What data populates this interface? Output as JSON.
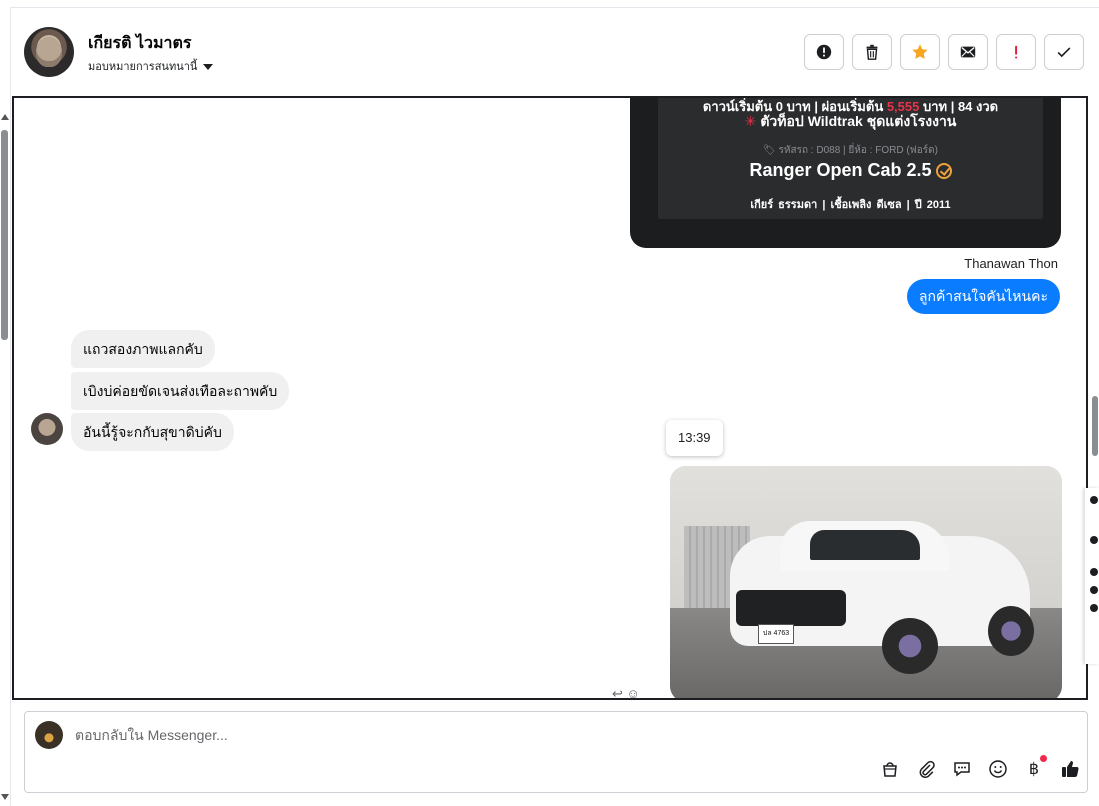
{
  "header": {
    "contact_name": "เกียรติ ไวมาตร",
    "assign_label": "มอบหมายการสนทนานี้"
  },
  "actions": [
    {
      "name": "report-spam-button",
      "icon": "alert-circle-icon"
    },
    {
      "name": "delete-button",
      "icon": "trash-icon"
    },
    {
      "name": "star-button",
      "icon": "star-icon"
    },
    {
      "name": "mark-unread-button",
      "icon": "envelope-icon"
    },
    {
      "name": "follow-up-button",
      "icon": "exclamation-icon"
    },
    {
      "name": "mark-done-button",
      "icon": "check-icon"
    }
  ],
  "card": {
    "line1_prefix": "ดาวน์เริ่มต้น 0 บาท | ผ่อนเริ่มต้น ",
    "line1_price": "5,555",
    "line1_suffix": " บาท | 84 งวด",
    "line2": "ตัวท็อป Wildtrak ชุดแต่งโรงงาน",
    "line3": "รหัสรถ : D088 | ยี่ห้อ : FORD (ฟอร์ด)",
    "title": "Ranger Open Cab 2.5",
    "line5": "เกียร์ ธรรมดา  |  เชื้อเพลิง ดีเซล  |  ปี 2011"
  },
  "messages": {
    "sender_name": "Thanawan Thon",
    "outgoing_text": "ลูกค้าสนใจคันไหนคะ",
    "incoming": [
      "แถวสองภาพแลกคับ",
      "เบิงบ่ค่อยขัดเจนส่งเทือละถาพคับ",
      "อันนี้รู้จะกกับสุขาดิบ่คับ"
    ],
    "timestamp": "13:39",
    "photo_plate": "ปล 4763"
  },
  "composer": {
    "placeholder": "ตอบกลับใน Messenger..."
  },
  "colors": {
    "messenger_blue": "#0a7cff",
    "star_orange": "#f5a623",
    "danger_red": "#e41e3f"
  }
}
